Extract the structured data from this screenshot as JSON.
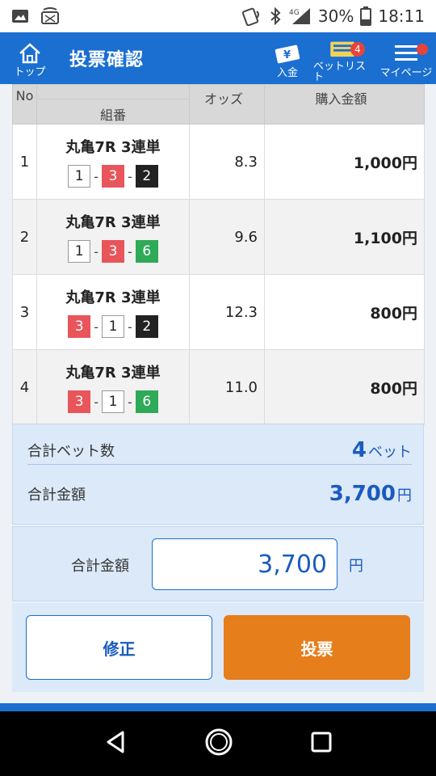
{
  "status_bar": {
    "battery": "30%",
    "time": "18:11",
    "network": "4G"
  },
  "header": {
    "home_label": "トップ",
    "title": "投票確認",
    "deposit_label": "入金",
    "betlist_label": "ベットリスト",
    "betlist_badge": "4",
    "mypage_label": "マイページ"
  },
  "table": {
    "headers": {
      "no": "No",
      "combo": "組番",
      "odds": "オッズ",
      "amount": "購入金額"
    },
    "rows": [
      {
        "no": "1",
        "race": "丸亀7R 3連単",
        "boats": [
          "1",
          "3",
          "2"
        ],
        "odds": "8.3",
        "amount": "1,000円"
      },
      {
        "no": "2",
        "race": "丸亀7R 3連単",
        "boats": [
          "1",
          "3",
          "6"
        ],
        "odds": "9.6",
        "amount": "1,100円"
      },
      {
        "no": "3",
        "race": "丸亀7R 3連単",
        "boats": [
          "3",
          "1",
          "2"
        ],
        "odds": "12.3",
        "amount": "800円"
      },
      {
        "no": "4",
        "race": "丸亀7R 3連単",
        "boats": [
          "3",
          "1",
          "6"
        ],
        "odds": "11.0",
        "amount": "800円"
      }
    ]
  },
  "summary": {
    "bet_count_label": "合計ベット数",
    "bet_count_value": "4",
    "bet_count_unit": "ベット",
    "total_label": "合計金額",
    "total_value": "3,700",
    "total_unit": "円"
  },
  "confirm": {
    "label": "合計金額",
    "input_value": "3,700",
    "unit": "円"
  },
  "buttons": {
    "fix": "修正",
    "vote": "投票"
  },
  "colors": {
    "accent": "#1a6fd1",
    "vote_button": "#e67e1b",
    "boat_1": "#ffffff",
    "boat_2": "#222222",
    "boat_3": "#e8555a",
    "boat_6": "#2faa58"
  }
}
